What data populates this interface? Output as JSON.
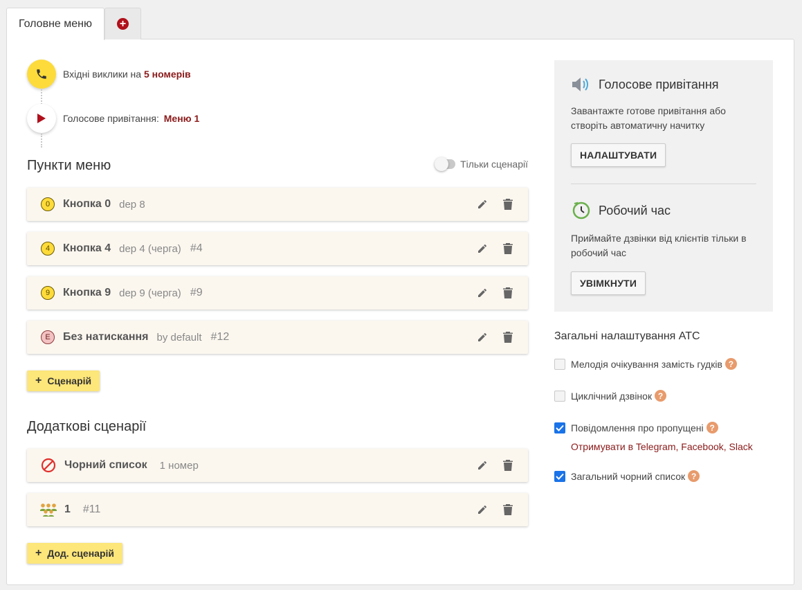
{
  "tabs": {
    "main_label": "Головне меню",
    "add_icon": "+"
  },
  "flow": {
    "incoming_prefix": "Вхідні виклики на",
    "incoming_link": "5 номерів",
    "greeting_prefix": "Голосове привітання:",
    "greeting_link": "Меню 1"
  },
  "menu_section": {
    "title": "Пункти меню",
    "toggle_label": "Тільки сценарії",
    "toggle_on": false,
    "items": [
      {
        "key": "0",
        "name": "Кнопка 0",
        "sub": "dep 8",
        "num": ""
      },
      {
        "key": "4",
        "name": "Кнопка 4",
        "sub": "dep 4 (черга)",
        "num": "#4"
      },
      {
        "key": "9",
        "name": "Кнопка 9",
        "sub": "dep 9 (черга)",
        "num": "#9"
      },
      {
        "key": "E",
        "name": "Без натискання",
        "sub": "by default",
        "num": "#12"
      }
    ],
    "add_button": "Сценарій"
  },
  "extra_section": {
    "title": "Додаткові сценарії",
    "items": [
      {
        "icon": "block-icon",
        "name": "Чорний список",
        "sub": "1 номер",
        "num": ""
      },
      {
        "icon": "people-icon",
        "name": "1",
        "sub": "",
        "num": "#11"
      }
    ],
    "add_button": "Дод. сценарій"
  },
  "voice_greeting": {
    "title": "Голосове привітання",
    "text": "Завантажте готове привітання або створіть автоматичну начитку",
    "button": "НАЛАШТУВАТИ"
  },
  "work_hours": {
    "title": "Робочий час",
    "text": "Приймайте дзвінки від клієнтів тільки в робочий час",
    "button": "УВІМКНУТИ"
  },
  "general": {
    "title": "Загальні налаштування АТС",
    "options": [
      {
        "label": "Мелодія очікування замість гудків",
        "checked": false
      },
      {
        "label": "Циклічний дзвінок",
        "checked": false
      },
      {
        "label": "Повідомлення про пропущені",
        "checked": true
      },
      {
        "label": "Загальний чорний список",
        "checked": true
      }
    ],
    "missed_links": {
      "prefix": "Отримувати в",
      "telegram": "Telegram",
      "facebook": "Facebook",
      "slack": "Slack"
    }
  },
  "colors": {
    "accent_yellow": "#fddb3a",
    "brand_red": "#b0101b",
    "link_red": "#8b1a1a",
    "check_blue": "#1a73e8"
  }
}
